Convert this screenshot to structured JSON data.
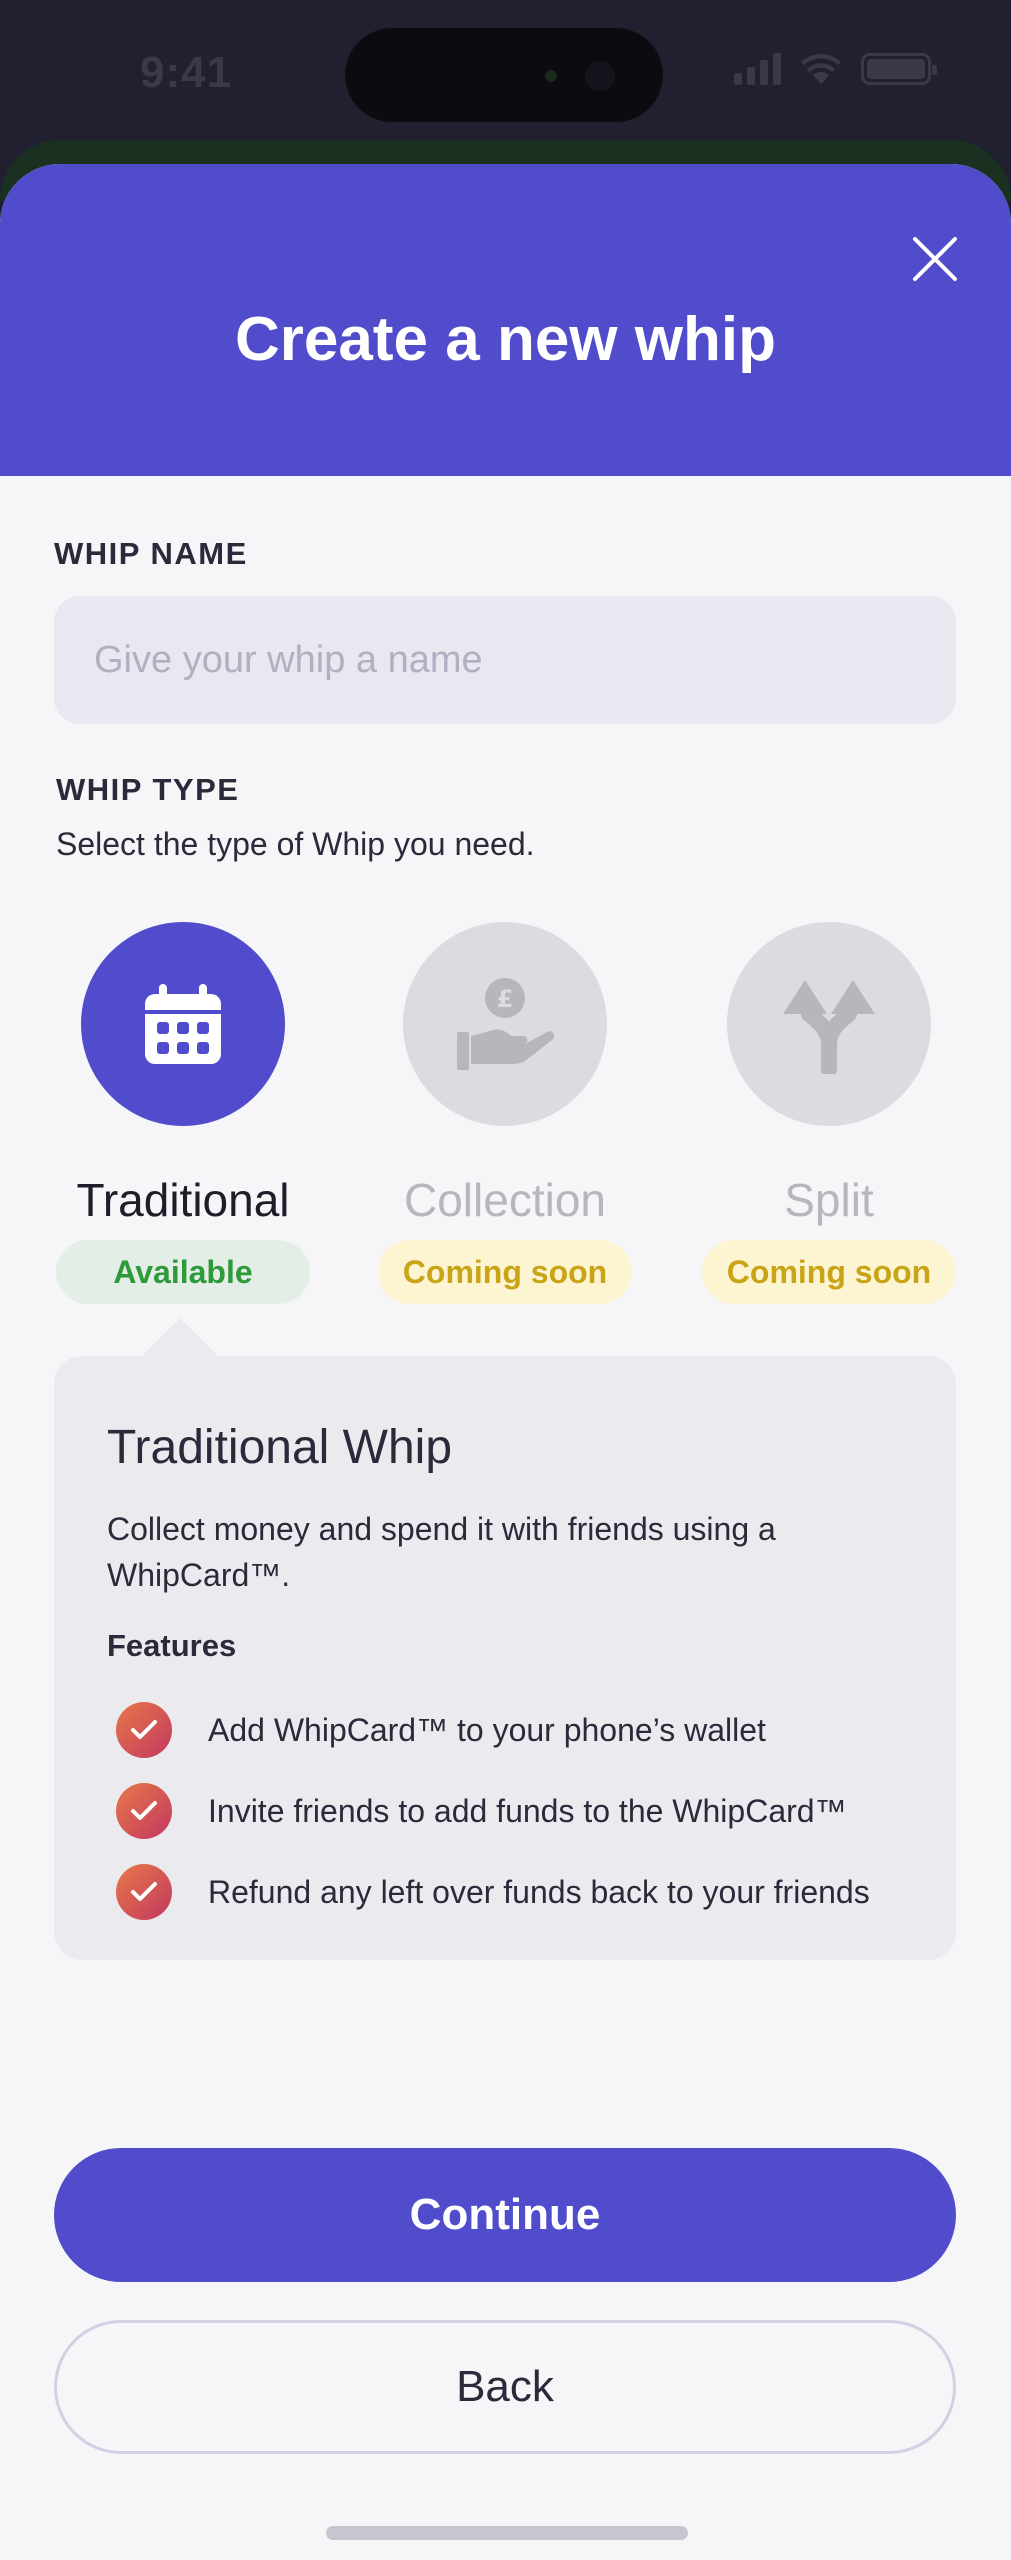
{
  "status_bar": {
    "time": "9:41"
  },
  "header": {
    "title": "Create a new whip",
    "close_icon": "close-icon"
  },
  "whip_name": {
    "label": "WHIP NAME",
    "placeholder": "Give your whip a name",
    "value": ""
  },
  "whip_type": {
    "label": "WHIP TYPE",
    "subtitle": "Select the type of Whip you need.",
    "options": [
      {
        "name": "Traditional",
        "badge": "Available",
        "icon": "calendar-icon",
        "selected": true
      },
      {
        "name": "Collection",
        "badge": "Coming soon",
        "icon": "pound-hand-icon",
        "selected": false
      },
      {
        "name": "Split",
        "badge": "Coming soon",
        "icon": "split-arrows-icon",
        "selected": false
      }
    ]
  },
  "info_card": {
    "title": "Traditional Whip",
    "description": "Collect money and spend it with friends using a WhipCard™.",
    "features_heading": "Features",
    "features": [
      "Add WhipCard™ to your phone’s wallet",
      "Invite friends to add funds to the WhipCard™",
      "Refund any left over funds back to your friends"
    ]
  },
  "buttons": {
    "continue": "Continue",
    "back": "Back"
  },
  "colors": {
    "brand": "#514ccb",
    "available_bg": "#e4ede6",
    "available_text": "#2e9a3a",
    "soon_bg": "#fdf4d2",
    "soon_text": "#c9a416",
    "disabled_circle": "#dcdce0",
    "disabled_text": "#b6b6bc"
  }
}
